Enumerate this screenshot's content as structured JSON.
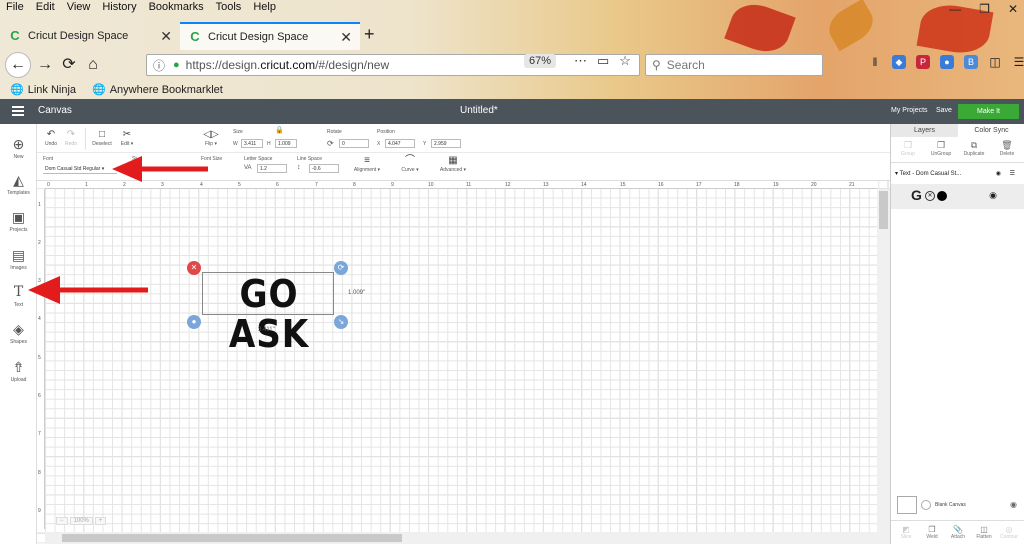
{
  "browser": {
    "menu": [
      "File",
      "Edit",
      "View",
      "History",
      "Bookmarks",
      "Tools",
      "Help"
    ],
    "tabs": [
      {
        "title": "Cricut Design Space",
        "active": false
      },
      {
        "title": "Cricut Design Space",
        "active": true
      }
    ],
    "url_prefix": "https://design.",
    "url_domain": "cricut.com",
    "url_suffix": "/#/design/new",
    "zoom": "67%",
    "search_placeholder": "Search",
    "bookmarks": [
      "Link Ninja",
      "Anywhere Bookmarklet"
    ]
  },
  "app": {
    "menu_label": "Canvas",
    "document_title": "Untitled*",
    "my_projects": "My Projects",
    "save": "Save",
    "make_it": "Make It"
  },
  "left_nav": [
    {
      "label": "New",
      "icon": "plus-circle-icon"
    },
    {
      "label": "Templates",
      "icon": "shirt-icon"
    },
    {
      "label": "Projects",
      "icon": "projects-icon"
    },
    {
      "label": "Images",
      "icon": "image-icon"
    },
    {
      "label": "Text",
      "icon": "text-icon"
    },
    {
      "label": "Shapes",
      "icon": "shapes-icon"
    },
    {
      "label": "Upload",
      "icon": "upload-icon"
    }
  ],
  "toolbar": {
    "undo": "Undo",
    "redo": "Redo",
    "deselect": "Deselect",
    "edit": "Edit",
    "flip": "Flip",
    "size_label": "Size",
    "w_label": "W",
    "w_value": "3.411",
    "h_label": "H",
    "h_value": "1.009",
    "rotate_label": "Rotate",
    "rotate_value": "0",
    "position_label": "Position",
    "x_label": "X",
    "x_value": "4.047",
    "y_label": "Y",
    "y_value": "2.959",
    "font_label": "Font",
    "font_value": "Dom Casual Std Regular",
    "style_label": "St",
    "font_size_label": "Font Size",
    "letter_space_label": "Letter Space",
    "letter_space_value": "1.2",
    "line_space_label": "Line Space",
    "line_space_value": "-0.6",
    "alignment": "Alignment",
    "curve": "Curve",
    "advanced": "Advanced"
  },
  "rulers": {
    "horizontal": [
      "0",
      "1",
      "2",
      "3",
      "4",
      "5",
      "6",
      "7",
      "8",
      "9",
      "10",
      "11",
      "12",
      "13",
      "14",
      "15",
      "16",
      "17",
      "18",
      "19",
      "20",
      "21"
    ],
    "vertical": [
      "1",
      "2",
      "3",
      "4",
      "5",
      "6",
      "7",
      "8",
      "9"
    ]
  },
  "canvas": {
    "text": "GO ASK",
    "height_dim": "1.009\"",
    "width_dim": "3.411\"",
    "zoom_value": "100%"
  },
  "right_panel": {
    "tabs": [
      "Layers",
      "Color Sync"
    ],
    "actions": [
      "Group",
      "UnGroup",
      "Duplicate",
      "Delete"
    ],
    "layer_title": "Text - Dom Casual St...",
    "blank_canvas": "Blank Canvas",
    "bottom_actions": [
      "Slice",
      "Weld",
      "Attach",
      "Flatten",
      "Contour"
    ]
  },
  "colors": {
    "header": "#4b545b",
    "make_it": "#3aa935",
    "arrow": "#e21c1c",
    "handle_delete": "#e04848",
    "handle_blue": "#7aa6d8"
  }
}
